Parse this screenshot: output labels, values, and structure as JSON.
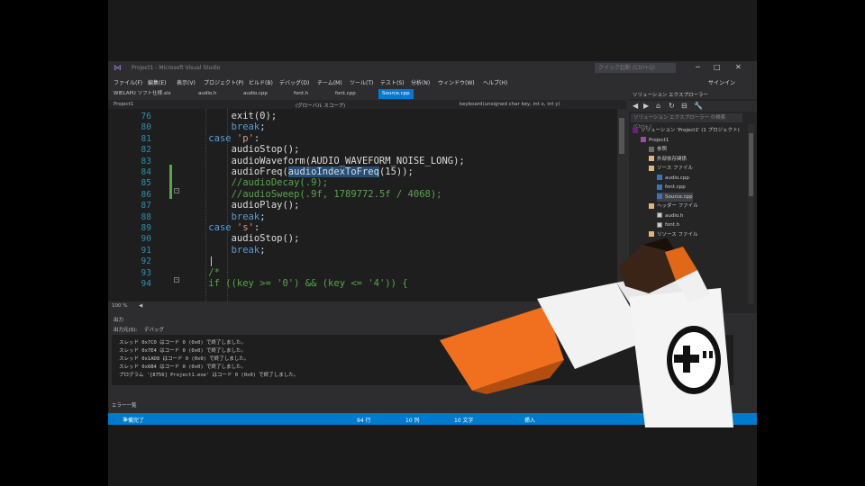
{
  "window": {
    "title": "Project1 - Microsoft Visual Studio",
    "quick_launch": "クイック起動 (Ctrl+Q)",
    "minimize": "─",
    "maximize": "□",
    "close": "✕"
  },
  "menu": {
    "items": [
      "ファイル(F)",
      "編集(E)",
      "表示(V)",
      "プロジェクト(P)",
      "ビルド(B)",
      "デバッグ(D)",
      "チーム(M)",
      "ツール(T)",
      "テスト(S)",
      "分析(N)",
      "ウィンドウ(W)",
      "ヘルプ(H)"
    ],
    "signin": "サインイン"
  },
  "tabs": [
    "WIELAPU ソフト仕様.xls",
    "audio.h",
    "audio.cpp",
    "font.h",
    "font.cpp",
    "Source.cpp"
  ],
  "active_tab": "Source.cpp",
  "navbar": {
    "project": "Project1",
    "scope": "(グローバル スコープ)",
    "function": "keyboard(unsigned char key, int x, int y)"
  },
  "code_lines": [
    {
      "n": "76",
      "segments": [
        {
          "t": "        exit(0);",
          "c": ""
        }
      ]
    },
    {
      "n": "80",
      "segments": [
        {
          "t": "        ",
          "c": ""
        },
        {
          "t": "break",
          "c": "kw"
        },
        {
          "t": ";",
          "c": ""
        }
      ]
    },
    {
      "n": "81",
      "segments": [
        {
          "t": "    ",
          "c": ""
        },
        {
          "t": "case",
          "c": "kw"
        },
        {
          "t": " ",
          "c": ""
        },
        {
          "t": "'p'",
          "c": "str"
        },
        {
          "t": ":",
          "c": ""
        }
      ]
    },
    {
      "n": "82",
      "segments": [
        {
          "t": "        audioStop();",
          "c": ""
        }
      ]
    },
    {
      "n": "83",
      "segments": [
        {
          "t": "        audioWaveform(AUDIO_WAVEFORM_NOISE_LONG);",
          "c": ""
        }
      ]
    },
    {
      "n": "84",
      "segments": [
        {
          "t": "        audioFreq(",
          "c": ""
        },
        {
          "t": "audioIndexToFreq",
          "c": "hl"
        },
        {
          "t": "(15));",
          "c": ""
        }
      ]
    },
    {
      "n": "85",
      "segments": [
        {
          "t": "        ",
          "c": ""
        },
        {
          "t": "//audioDecay(.9);",
          "c": "cm"
        }
      ]
    },
    {
      "n": "86",
      "segments": [
        {
          "t": "        ",
          "c": ""
        },
        {
          "t": "//audioSweep(.9f, 1789772.5f / 4068);",
          "c": "cm"
        }
      ]
    },
    {
      "n": "87",
      "segments": [
        {
          "t": "        audioPlay();",
          "c": ""
        }
      ]
    },
    {
      "n": "88",
      "segments": [
        {
          "t": "        ",
          "c": ""
        },
        {
          "t": "break",
          "c": "kw"
        },
        {
          "t": ";",
          "c": ""
        }
      ]
    },
    {
      "n": "89",
      "segments": [
        {
          "t": "    ",
          "c": ""
        },
        {
          "t": "case",
          "c": "kw"
        },
        {
          "t": " ",
          "c": ""
        },
        {
          "t": "'s'",
          "c": "str"
        },
        {
          "t": ":",
          "c": ""
        }
      ]
    },
    {
      "n": "90",
      "segments": [
        {
          "t": "        audioStop();",
          "c": ""
        }
      ]
    },
    {
      "n": "91",
      "segments": [
        {
          "t": "        ",
          "c": ""
        },
        {
          "t": "break",
          "c": "kw"
        },
        {
          "t": ";",
          "c": ""
        }
      ]
    },
    {
      "n": "92",
      "segments": [
        {
          "t": "    |",
          "c": ""
        }
      ]
    },
    {
      "n": "93",
      "segments": [
        {
          "t": "    ",
          "c": ""
        },
        {
          "t": "/*",
          "c": "cm"
        }
      ]
    },
    {
      "n": "94",
      "segments": [
        {
          "t": "    ",
          "c": ""
        },
        {
          "t": "if ((key >= '0') && (key <= '4')) {",
          "c": "cm"
        }
      ]
    }
  ],
  "zoom": {
    "level": "100 %",
    "pos": "◀"
  },
  "output": {
    "title": "出力",
    "source_label": "出力元(S):",
    "source_value": "デバッグ",
    "lines": [
      "スレッド 0x7C0 はコード 0 (0x0) で終了しました。",
      "スレッド 0x7E4 はコード 0 (0x0) で終了しました。",
      "スレッド 0x1AD8 はコード 0 (0x0) で終了しました。",
      "スレッド 0x6B4 はコード 0 (0x0) で終了しました。",
      "プログラム '[8756] Project1.exe' はコード 0 (0x0) で終了しました。"
    ]
  },
  "error_list": "エラー一覧",
  "status": {
    "left": "準備完了",
    "line": "94 行",
    "col": "10 列",
    "ch": "10 文字",
    "mode": "挿入"
  },
  "solution_explorer": {
    "title": "ソリューション エクスプローラー",
    "search": "ソリューション エクスプローラー の検索 (Ctrl+;)",
    "items": [
      {
        "label": "ソリューション 'Project1' (1 プロジェクト)",
        "indent": 0,
        "icon": "sol"
      },
      {
        "label": "Project1",
        "indent": 1,
        "icon": "proj"
      },
      {
        "label": "参照",
        "indent": 2,
        "icon": "ref"
      },
      {
        "label": "外部依存関係",
        "indent": 2,
        "icon": "folder"
      },
      {
        "label": "ソース ファイル",
        "indent": 2,
        "icon": "folder"
      },
      {
        "label": "audio.cpp",
        "indent": 3,
        "icon": "cpp"
      },
      {
        "label": "font.cpp",
        "indent": 3,
        "icon": "cpp"
      },
      {
        "label": "Source.cpp",
        "indent": 3,
        "icon": "cpp"
      },
      {
        "label": "ヘッダー ファイル",
        "indent": 2,
        "icon": "folder"
      },
      {
        "label": "audio.h",
        "indent": 3,
        "icon": "file"
      },
      {
        "label": "font.h",
        "indent": 3,
        "icon": "file"
      },
      {
        "label": "リソース ファイル",
        "indent": 2,
        "icon": "folder"
      }
    ],
    "selected_index": 7
  },
  "colors": {
    "accent": "#007acc",
    "shirt": "#eeeeee",
    "sleeve": "#f07020",
    "skin": "#3a2418"
  }
}
